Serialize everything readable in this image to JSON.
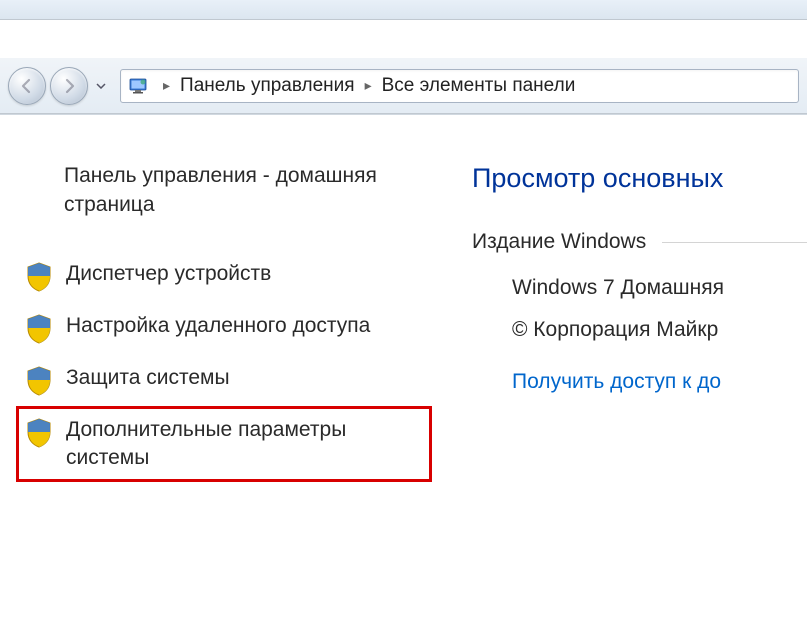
{
  "breadcrumb": {
    "items": [
      "Панель управления",
      "Все элементы панели"
    ]
  },
  "sidebar": {
    "title": "Панель управления - домашняя страница",
    "items": [
      {
        "label": "Диспетчер устройств"
      },
      {
        "label": "Настройка удаленного доступа"
      },
      {
        "label": "Защита системы"
      },
      {
        "label": "Дополнительные параметры системы"
      }
    ]
  },
  "main": {
    "heading": "Просмотр основных",
    "group_label": "Издание Windows",
    "edition": "Windows 7 Домашняя",
    "copyright": "© Корпорация Майкр",
    "link": "Получить доступ к до"
  }
}
